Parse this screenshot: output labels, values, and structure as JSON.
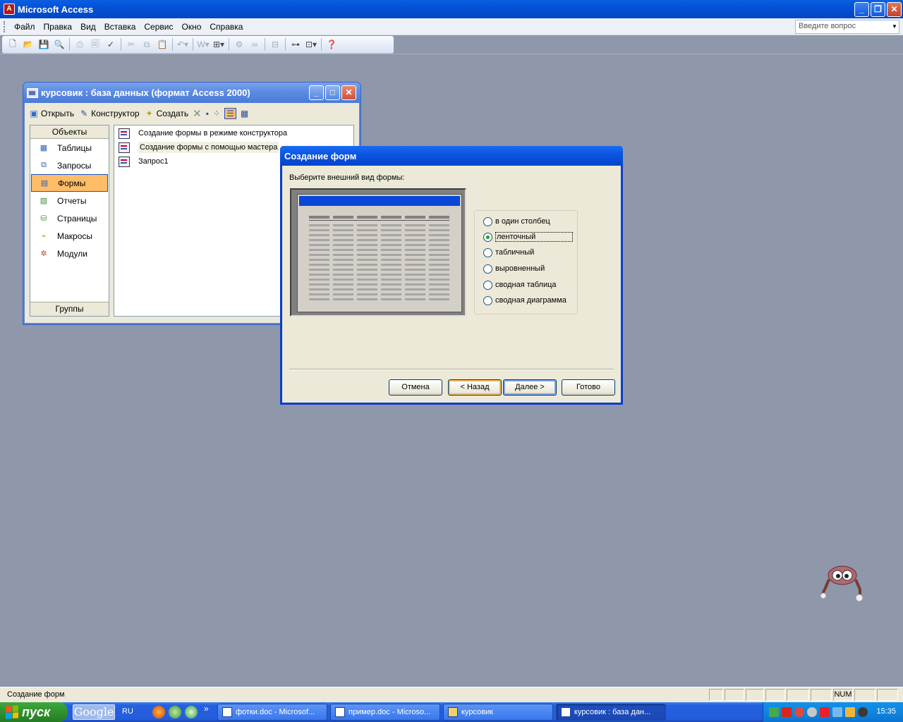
{
  "app": {
    "title": "Microsoft Access",
    "icon_letter": "A",
    "minimize_glyph": "_",
    "restore_glyph": "❐",
    "close_glyph": "✕"
  },
  "menubar": {
    "items": [
      {
        "label": "Файл"
      },
      {
        "label": "Правка"
      },
      {
        "label": "Вид"
      },
      {
        "label": "Вставка"
      },
      {
        "label": "Сервис"
      },
      {
        "label": "Окно"
      },
      {
        "label": "Справка"
      }
    ],
    "ask_placeholder": "Введите вопрос"
  },
  "toolbar": {
    "icons": [
      "new-icon",
      "open-icon",
      "save-icon",
      "search-file-icon",
      "print-icon",
      "print-preview-icon",
      "spelling-icon",
      "cut-icon",
      "copy-icon",
      "paste-icon",
      "undo-icon",
      "office-links-icon",
      "analyze-icon",
      "code-icon",
      "properties-icon",
      "relationships-icon",
      "new-object-icon",
      "help-icon"
    ]
  },
  "db_window": {
    "title": "курсовик : база данных (формат Access 2000)",
    "toolbar": {
      "open_label": "Открыть",
      "design_label": "Конструктор",
      "create_label": "Создать"
    },
    "objects_header": "Объекты",
    "objects": [
      {
        "label": "Таблицы",
        "icon": "table-icon",
        "selected": false
      },
      {
        "label": "Запросы",
        "icon": "query-icon",
        "selected": false
      },
      {
        "label": "Формы",
        "icon": "form-icon",
        "selected": true
      },
      {
        "label": "Отчеты",
        "icon": "report-icon",
        "selected": false
      },
      {
        "label": "Страницы",
        "icon": "page-icon",
        "selected": false
      },
      {
        "label": "Макросы",
        "icon": "macro-icon",
        "selected": false
      },
      {
        "label": "Модули",
        "icon": "module-icon",
        "selected": false
      }
    ],
    "groups_label": "Группы",
    "list_items": [
      {
        "label": "Создание формы в режиме конструктора"
      },
      {
        "label": "Создание формы с помощью мастера"
      },
      {
        "label": "Запрос1"
      }
    ]
  },
  "wizard": {
    "title": "Создание форм",
    "prompt": "Выберите внешний вид формы:",
    "options": [
      {
        "label": "в один столбец",
        "selected": false
      },
      {
        "label": "ленточный",
        "selected": true
      },
      {
        "label": "табличный",
        "selected": false
      },
      {
        "label": "выровненный",
        "selected": false
      },
      {
        "label": "сводная таблица",
        "selected": false
      },
      {
        "label": "сводная диаграмма",
        "selected": false
      }
    ],
    "buttons": {
      "cancel": "Отмена",
      "back": "< Назад",
      "next": "Далее >",
      "finish": "Готово"
    }
  },
  "statusbar": {
    "text": "Создание форм",
    "num_indicator": "NUM"
  },
  "taskbar": {
    "start_label": "пуск",
    "google_label": "Google",
    "language": "RU",
    "chevron": "»",
    "tasks": [
      {
        "label": "фотки.doc - Microsof...",
        "active": false
      },
      {
        "label": "пример.doc - Microso...",
        "active": false
      },
      {
        "label": "курсовик",
        "active": false
      },
      {
        "label": "курсовик : база дан...",
        "active": true
      }
    ],
    "clock": "15:35"
  },
  "colors": {
    "desktop": "#8f97ab",
    "selection": "#ffbd69",
    "title_blue": "#0451d8"
  }
}
